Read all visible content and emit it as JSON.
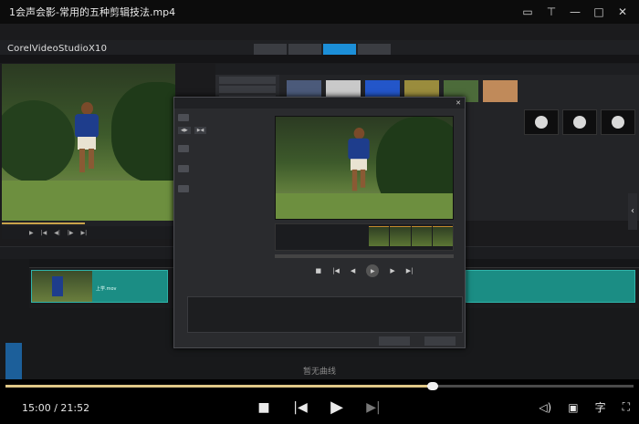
{
  "player": {
    "title": "1会声会影-常用的五种剪辑技法.mp4",
    "time_current": "15:00",
    "time_separator": " / ",
    "time_total": "21:52",
    "progress": 0.68,
    "no_curve_text": "暂无曲线",
    "subtitle_label": "字"
  },
  "app": {
    "logo": "CorelVideoStudioX10"
  },
  "colors": {
    "accent": "#1c8fd8",
    "clip": "#1b8d84",
    "played": "#e0c888"
  },
  "timeline": {
    "clip_label": "上学.mov"
  }
}
